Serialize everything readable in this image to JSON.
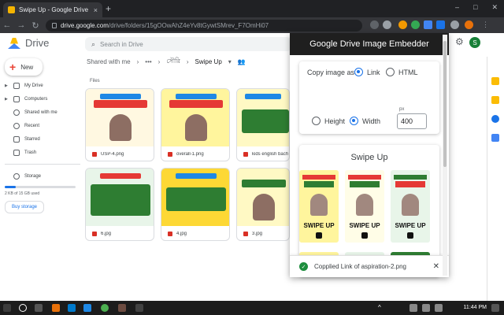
{
  "browser": {
    "tab_title": "Swipe Up - Google Drive",
    "new_tab": "+",
    "close_tab": "×",
    "window_controls": [
      "–",
      "□",
      "✕"
    ],
    "url_host": "drive.google.com",
    "url_path": "/drive/folders/15gOOwAhZ4eYv8tGywtSMrev_F7OmHi07"
  },
  "drive": {
    "app_name": "Drive",
    "search_placeholder": "Search in Drive",
    "avatar_letter": "S",
    "new_label": "New",
    "sidebar": {
      "items": [
        {
          "label": "My Drive",
          "icon": "my-drive-icon",
          "caret": true
        },
        {
          "label": "Computers",
          "icon": "computer-icon",
          "caret": true
        },
        {
          "label": "Shared with me",
          "icon": "shared-icon",
          "caret": false
        },
        {
          "label": "Recent",
          "icon": "clock-icon",
          "caret": false
        },
        {
          "label": "Starred",
          "icon": "star-icon",
          "caret": false
        },
        {
          "label": "Trash",
          "icon": "trash-icon",
          "caret": false
        }
      ],
      "storage_label": "Storage",
      "storage_used": "2 KB of 15 GB used",
      "storage_fraction": 0.0001,
      "buy_storage": "Buy storage"
    },
    "breadcrumb": {
      "root": "Shared with me",
      "ellipsis": "•••",
      "folder": "সৌরি",
      "current": "Swipe Up"
    },
    "files_label": "Files",
    "files": [
      {
        "name": "USP-4.png",
        "bg": "#fff8e1"
      },
      {
        "name": "overall-1.png",
        "bg": "#fff59d"
      },
      {
        "name": "kids english bach",
        "bg": "#fff9c4"
      },
      {
        "name": "6.jpg",
        "bg": "#e8f5e9"
      },
      {
        "name": "4.jpg",
        "bg": "#fdd835"
      },
      {
        "name": "3.jpg",
        "bg": "#fff9c4"
      }
    ]
  },
  "popup": {
    "title": "Google Drive Image Embedder",
    "copy_as_label": "Copy image as",
    "link_label": "Link",
    "html_label": "HTML",
    "height_label": "Height",
    "width_label": "Width",
    "copy_as_selected": "Link",
    "dimension_selected": "Width",
    "px_unit": "px",
    "px_value": "400",
    "album_title": "Swipe Up",
    "swipe_text": "SWIPE UP",
    "toast_text": "Copplied Link of aspiration-2.png",
    "toast_close": "✕"
  },
  "taskbar": {
    "time": "11:44 PM"
  },
  "colors": {
    "accent": "#1a73e8",
    "popup_header": "#1f1f1f",
    "success": "#1e8e3e"
  }
}
